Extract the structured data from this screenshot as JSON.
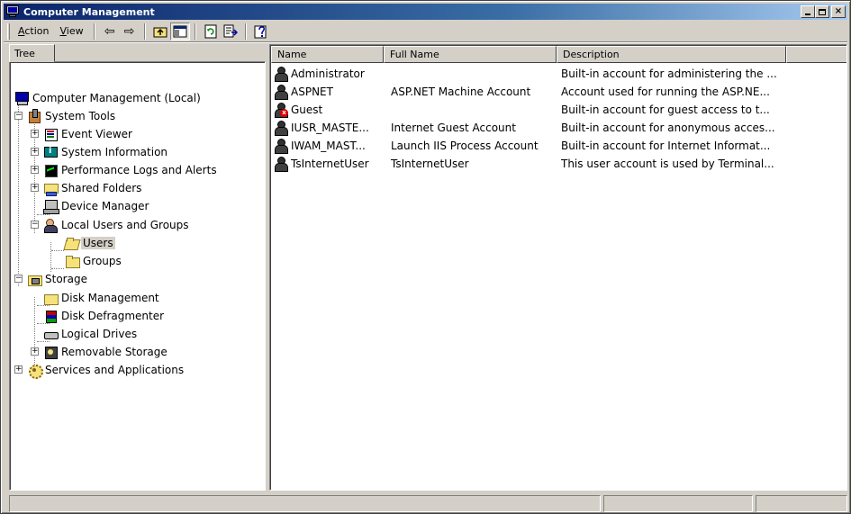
{
  "window": {
    "title": "Computer Management",
    "minimize_label": "_",
    "close_label": "×"
  },
  "toolbar": {
    "menus": [
      {
        "label": "Action",
        "accel": "A",
        "rest": "ction"
      },
      {
        "label": "View",
        "accel": "V",
        "rest": "iew"
      }
    ],
    "back_glyph": "⇦",
    "forward_glyph": "⇨",
    "buttons": [
      "back-arrow-icon",
      "forward-arrow-icon",
      "up-one-level-icon",
      "show-hide-tree-icon",
      "refresh-icon",
      "export-list-icon",
      "help-icon"
    ]
  },
  "tree": {
    "tab_label": "Tree",
    "items": [
      {
        "label": "Computer Management (Local)",
        "icon": "computer-icon"
      },
      {
        "label": "System Tools",
        "icon": "tools-icon"
      },
      {
        "label": "Event Viewer",
        "icon": "event-viewer-icon"
      },
      {
        "label": "System Information",
        "icon": "system-information-icon"
      },
      {
        "label": "Performance Logs and Alerts",
        "icon": "performance-icon"
      },
      {
        "label": "Shared Folders",
        "icon": "shared-folder-icon"
      },
      {
        "label": "Device Manager",
        "icon": "device-manager-icon"
      },
      {
        "label": "Local Users and Groups",
        "icon": "users-groups-icon"
      },
      {
        "label": "Users",
        "icon": "open-folder-icon",
        "selected": true
      },
      {
        "label": "Groups",
        "icon": "folder-icon"
      },
      {
        "label": "Storage",
        "icon": "storage-icon"
      },
      {
        "label": "Disk Management",
        "icon": "disk-management-icon"
      },
      {
        "label": "Disk Defragmenter",
        "icon": "disk-defragmenter-icon"
      },
      {
        "label": "Logical Drives",
        "icon": "logical-drives-icon"
      },
      {
        "label": "Removable Storage",
        "icon": "removable-storage-icon"
      },
      {
        "label": "Services and Applications",
        "icon": "services-icon"
      }
    ],
    "expander_plus": "+",
    "expander_minus": "−"
  },
  "list": {
    "columns": [
      "Name",
      "Full Name",
      "Description"
    ],
    "rows": [
      {
        "name": "Administrator",
        "full_name": "",
        "description": "Built-in account for administering the ...",
        "disabled": false
      },
      {
        "name": "ASPNET",
        "full_name": "ASP.NET Machine Account",
        "description": "Account used for running the ASP.NE...",
        "disabled": false
      },
      {
        "name": "Guest",
        "full_name": "",
        "description": "Built-in account for guest access to t...",
        "disabled": true
      },
      {
        "name": "IUSR_MASTE...",
        "full_name": "Internet Guest Account",
        "description": "Built-in account for anonymous acces...",
        "disabled": false
      },
      {
        "name": "IWAM_MAST...",
        "full_name": "Launch IIS Process Account",
        "description": "Built-in account for Internet Informat...",
        "disabled": false
      },
      {
        "name": "TsInternetUser",
        "full_name": "TsInternetUser",
        "description": "This user account is used by Terminal...",
        "disabled": false
      }
    ],
    "disabled_badge": "x"
  },
  "colors": {
    "title_gradient_start": "#0a246a",
    "title_gradient_end": "#a6caf0",
    "face": "#d4d0c8",
    "selection": "#d4d0c8"
  }
}
